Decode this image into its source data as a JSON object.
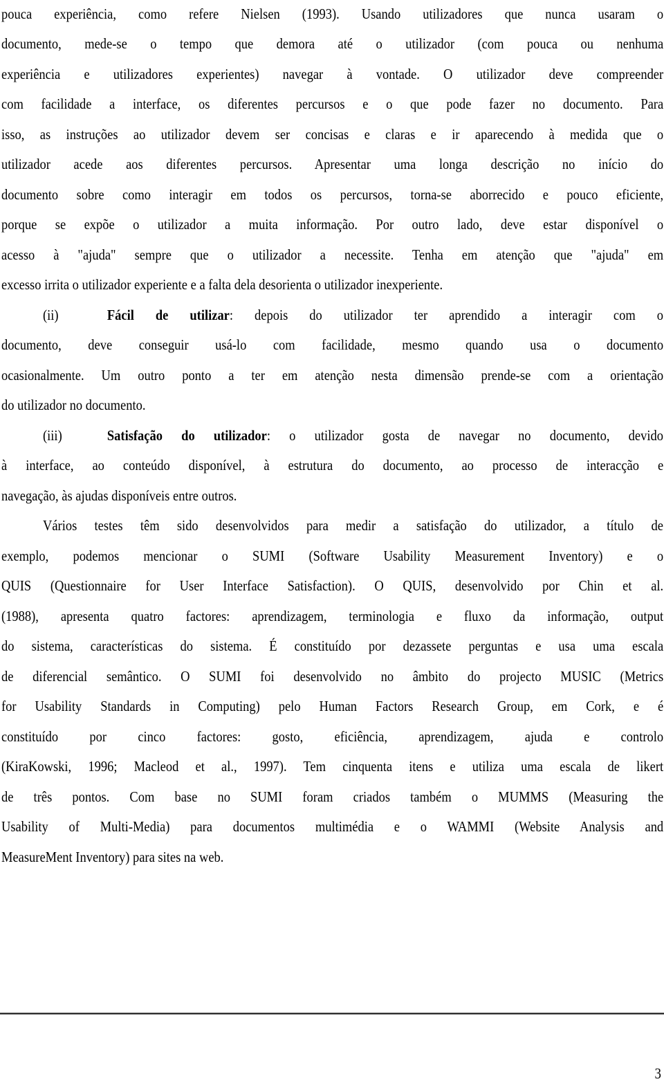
{
  "document": {
    "paragraphs": [
      {
        "id": "p1",
        "lines": [
          "pouca experiência, como refere Nielsen (1993). Usando utilizadores que nunca usaram o",
          "documento, mede-se o tempo que demora até o utilizador (com pouca ou nenhuma",
          "experiência e utilizadores experientes) navegar à vontade. O utilizador deve compreender",
          "com facilidade a interface, os diferentes percursos e o que pode fazer no documento. Para",
          "isso, as instruções ao utilizador devem ser concisas e claras e ir aparecendo à medida que o",
          "utilizador acede aos diferentes percursos. Apresentar uma longa descrição no início do",
          "documento sobre como interagir em todos os percursos, torna-se aborrecido e pouco eficiente,",
          "porque se expõe o utilizador a muita informação. Por outro lado, deve estar disponível o",
          "acesso à \"ajuda\" sempre que o utilizador a necessite. Tenha em atenção que \"ajuda\" em",
          "excesso irrita o utilizador experiente e a falta dela desorienta o utilizador inexperiente."
        ]
      },
      {
        "id": "item-ii",
        "number": "(ii)",
        "term": "Fácil de utilizar",
        "first_line_rest": ": depois do utilizador ter aprendido a interagir com o",
        "lines": [
          "documento, deve conseguir usá-lo com facilidade, mesmo quando usa o documento",
          "ocasionalmente. Um outro ponto a ter em atenção nesta dimensão prende-se com a orientação",
          "do utilizador no documento."
        ]
      },
      {
        "id": "item-iii",
        "number": "(iii)",
        "term": "Satisfação do utilizador",
        "first_line_rest": ": o utilizador  gosta de navegar no documento, devido",
        "lines": [
          "à interface, ao conteúdo disponível, à estrutura do documento, ao processo de interacção e",
          "navegação, às ajudas disponíveis entre outros."
        ]
      },
      {
        "id": "p2",
        "lines": [
          "Vários testes têm sido desenvolvidos para medir a satisfação do utilizador, a título de",
          "exemplo, podemos mencionar o SUMI (Software Usability Measurement Inventory) e o",
          "QUIS (Questionnaire for User Interface Satisfaction). O QUIS, desenvolvido por Chin et al.",
          "(1988), apresenta quatro factores: aprendizagem, terminologia e fluxo da informação, output",
          "do sistema, características do sistema. É constituído por dezassete perguntas e usa uma escala",
          "de diferencial semântico. O SUMI foi desenvolvido no âmbito do projecto MUSIC (Metrics",
          "for Usability Standards in Computing) pelo Human Factors Research Group, em Cork, e é",
          "constituído por cinco factores: gosto, eficiência, aprendizagem, ajuda e controlo",
          "(KiraKowski, 1996; Macleod et al., 1997). Tem cinquenta itens e utiliza uma escala de likert",
          "de três pontos. Com base no SUMI foram criados também o MUMMS (Measuring the",
          "Usability of Multi-Media) para documentos multimédia e o WAMMI (Website Analysis and",
          "MeasureMent Inventory) para sites na web."
        ]
      }
    ],
    "page_number": "3"
  }
}
